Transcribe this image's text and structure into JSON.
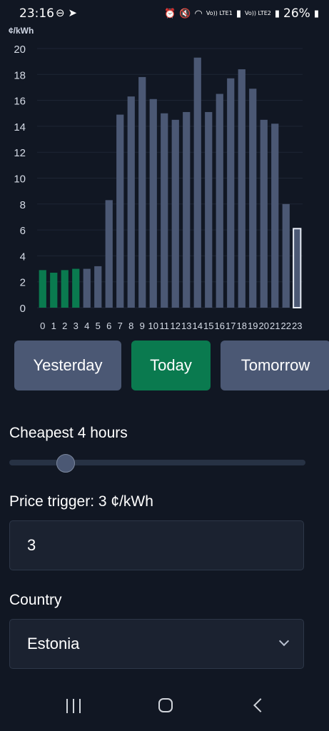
{
  "status_bar": {
    "time": "23:16",
    "left_icons": [
      "do-not-disturb-icon",
      "telegram-icon"
    ],
    "volte1": "Vo)) LTE1",
    "volte2": "Vo)) LTE2",
    "battery": "26%"
  },
  "chart_data": {
    "type": "bar",
    "ylabel": "¢/kWh",
    "ylim": [
      0,
      20
    ],
    "yticks": [
      "0",
      "2",
      "4",
      "6",
      "8",
      "10",
      "12",
      "14",
      "16",
      "18",
      "20"
    ],
    "categories": [
      "0",
      "1",
      "2",
      "3",
      "4",
      "5",
      "6",
      "7",
      "8",
      "9",
      "10",
      "11",
      "12",
      "13",
      "14",
      "15",
      "16",
      "17",
      "18",
      "19",
      "20",
      "21",
      "22",
      "23"
    ],
    "values": [
      2.9,
      2.7,
      2.9,
      3.0,
      3.0,
      3.2,
      8.3,
      14.9,
      16.3,
      17.8,
      16.1,
      15.0,
      14.5,
      15.1,
      19.3,
      15.1,
      16.5,
      17.7,
      18.4,
      16.9,
      14.5,
      14.2,
      8.0,
      6.1
    ],
    "highlight_cheapest": [
      0,
      1,
      2,
      3
    ],
    "current_hour": 23,
    "grid": true,
    "colors": {
      "normal": "#4b5874",
      "cheapest": "#0a7a4f",
      "current_border": "#e8edf5"
    }
  },
  "buttons": {
    "yesterday": "Yesterday",
    "today": "Today",
    "tomorrow": "Tomorrow",
    "active": "today"
  },
  "cheapest": {
    "label": "Cheapest 4 hours",
    "value": 4
  },
  "trigger": {
    "label": "Price trigger: 3 ¢/kWh",
    "value": "3"
  },
  "country": {
    "label": "Country",
    "value": "Estonia"
  },
  "navbar": [
    "recent-apps-icon",
    "home-icon",
    "back-icon"
  ],
  "colors": {
    "background": "#111723",
    "accent": "#0a7a4f",
    "button": "#4b5874"
  }
}
